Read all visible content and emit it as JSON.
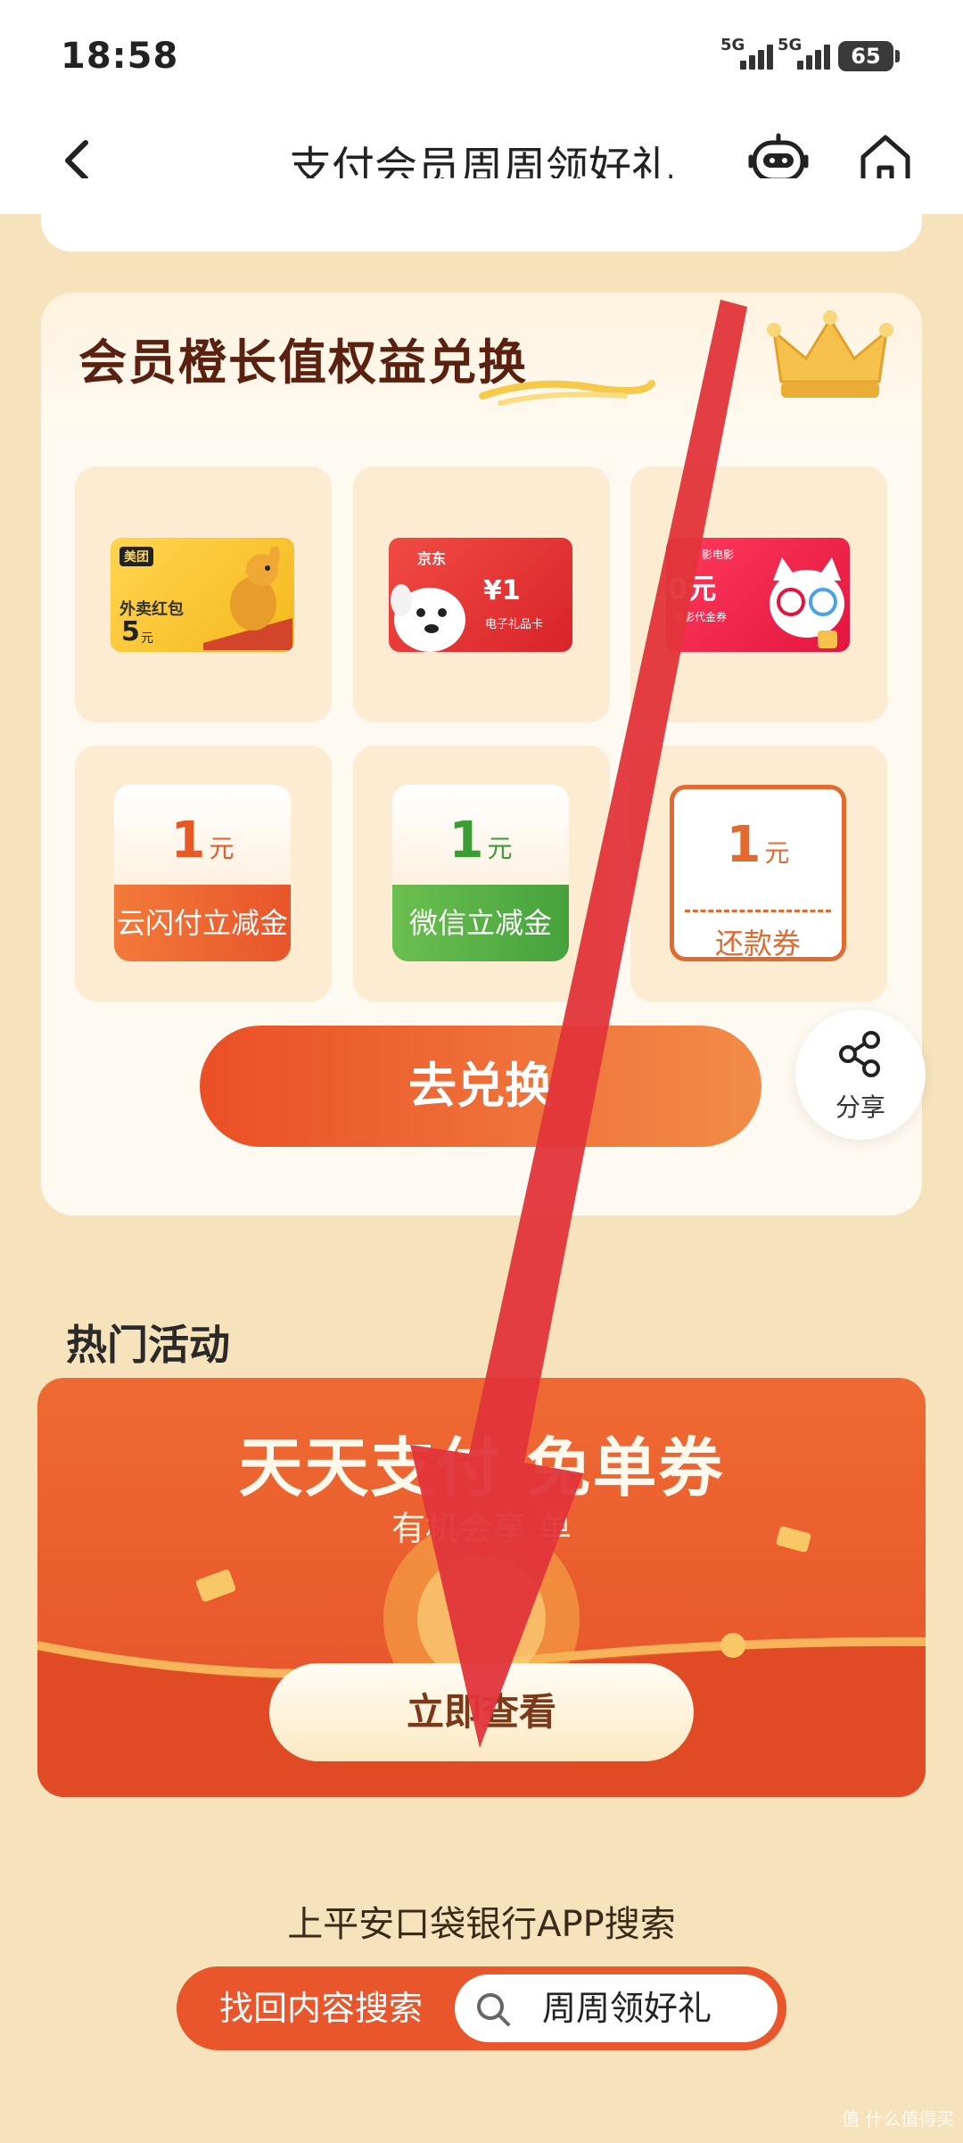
{
  "status_bar": {
    "time": "18:58",
    "signal1": "5G",
    "signal2": "5G",
    "battery": "65"
  },
  "nav": {
    "title": "支付会员周周领好礼",
    "icons": [
      "back-arrow-icon",
      "robot-assistant-icon",
      "home-icon"
    ]
  },
  "exchange": {
    "title": "会员橙长值权益兑换",
    "items": [
      {
        "type": "gift-card",
        "brand": "美团",
        "text": "外卖红包",
        "value": "5",
        "unit": "元"
      },
      {
        "type": "gift-card",
        "brand": "京东",
        "value": "¥1",
        "text": "电子礼品卡"
      },
      {
        "type": "gift-card",
        "brand": "影电影",
        "value": "0元",
        "text": "电影代金券"
      },
      {
        "type": "voucher",
        "value": "1",
        "unit": "元",
        "label": "云闪付立减金"
      },
      {
        "type": "voucher",
        "value": "1",
        "unit": "元",
        "label": "微信立减金"
      },
      {
        "type": "voucher",
        "value": "1",
        "unit": "元",
        "label": "还款券"
      }
    ],
    "button": "去兑换"
  },
  "share": {
    "label": "分享"
  },
  "hot": {
    "title": "热门活动",
    "banner": {
      "title": "天天支付 免单券",
      "subtitle": "有机会享 单",
      "button": "立即查看"
    }
  },
  "search": {
    "hint": "上平安口袋银行APP搜索",
    "pill_label": "找回内容搜索",
    "keyword": "周周领好礼"
  },
  "watermark": "值 什么值得买",
  "colors": {
    "page_bg": "#f6e3bc",
    "accent": "#e9562c",
    "arrow": "#e1343a"
  }
}
